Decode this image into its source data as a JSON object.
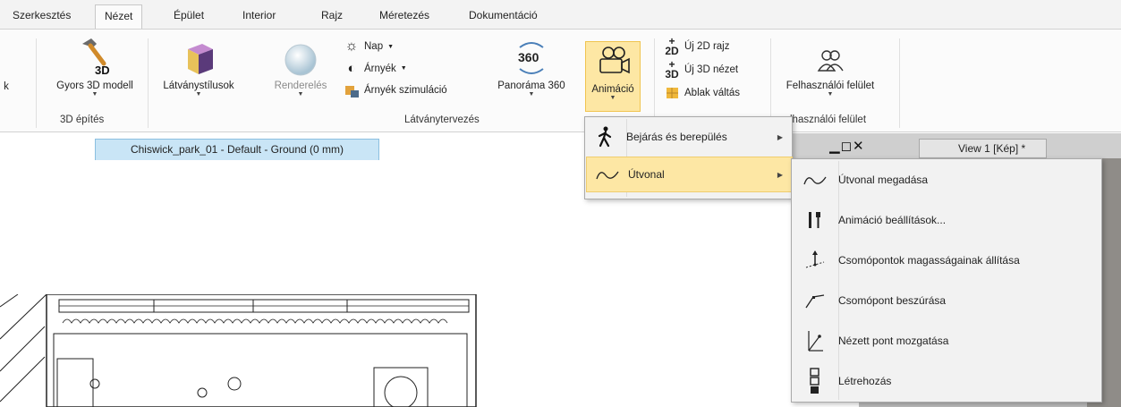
{
  "tabs": [
    "Szerkesztés",
    "Nézet",
    "Épület",
    "Interior",
    "Rajz",
    "Méretezés",
    "Dokumentáció"
  ],
  "active_tab": "Nézet",
  "ribbon": {
    "cut_left_label": "k",
    "gyors3d": "Gyors 3D modell",
    "gyors3d_icon_text": "3D",
    "group_3d": "3D építés",
    "latvanystilusok": "Látványstílusok",
    "rendereles": "Renderelés",
    "nap": "Nap",
    "arnyek": "Árnyék",
    "arnyek_szim": "Árnyék szimuláció",
    "panorama": "Panoráma 360",
    "panorama_icon_text": "360",
    "animacio": "Animáció",
    "group_latvany": "Látványtervezés",
    "uj2d": "Új 2D rajz",
    "uj2d_icon_text": "2D",
    "uj3d": "Új 3D nézet",
    "uj3d_icon_text": "3D",
    "ablak_valtas": "Ablak váltás",
    "felhasznaloi": "Felhasználói felület",
    "group_felhasznaloi": "lhasználói felület"
  },
  "document_tab": "Chiswick_park_01 - Default - Ground (0 mm)",
  "view_tab": "View 1 [Kép] *",
  "menu": {
    "items": [
      {
        "label": "Bejárás és berepülés",
        "icon": "walk-icon",
        "has_sub": true
      },
      {
        "label": "Útvonal",
        "icon": "path-curve-icon",
        "has_sub": true
      }
    ]
  },
  "submenu": {
    "items": [
      {
        "label": "Útvonal megadása",
        "icon": "path-curve-icon"
      },
      {
        "label": "Animáció beállítások...",
        "icon": "tools-icon"
      },
      {
        "label": "Csomópontok magasságainak állítása",
        "icon": "node-height-icon"
      },
      {
        "label": "Csomópont beszúrása",
        "icon": "node-insert-icon"
      },
      {
        "label": "Nézett pont mozgatása",
        "icon": "view-point-icon"
      },
      {
        "label": "Létrehozás",
        "icon": "create-frames-icon"
      }
    ]
  }
}
